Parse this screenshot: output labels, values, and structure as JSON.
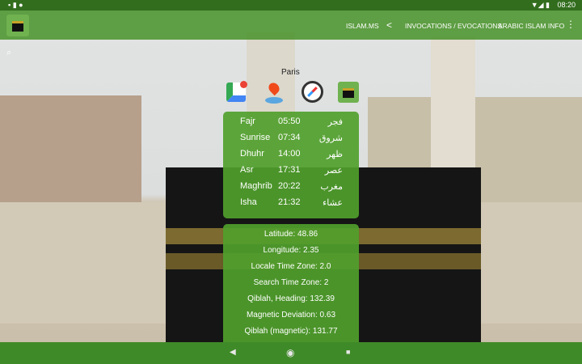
{
  "status_bar": {
    "time": "08:20"
  },
  "app_bar": {
    "menu": [
      "ISLAM.MS",
      "INVOCATIONS / EVOCATIONS",
      "ARABIC ISLAM INFO"
    ]
  },
  "city": "Paris",
  "icons": [
    "google-maps-icon",
    "location-pin-icon",
    "compass-icon",
    "kaaba-app-icon"
  ],
  "prayers": [
    {
      "name": "Fajr",
      "time": "05:50",
      "arabic": "فجر"
    },
    {
      "name": "Sunrise",
      "time": "07:34",
      "arabic": "شروق"
    },
    {
      "name": "Dhuhr",
      "time": "14:00",
      "arabic": "ظهر"
    },
    {
      "name": "Asr",
      "time": "17:31",
      "arabic": "عصر"
    },
    {
      "name": "Maghrib",
      "time": "20:22",
      "arabic": "مغرب"
    },
    {
      "name": "Isha",
      "time": "21:32",
      "arabic": "عشاء"
    }
  ],
  "info": [
    "Latitude: 48.86",
    "Longitude: 2.35",
    "Locale Time Zone: 2.0",
    "Search Time Zone: 2",
    "Qiblah, Heading: 132.39",
    "Magnetic Deviation: 0.63",
    "Qiblah (magnetic): 131.77"
  ],
  "nav": {
    "back": "◀",
    "home": "◉",
    "recent": "■"
  }
}
